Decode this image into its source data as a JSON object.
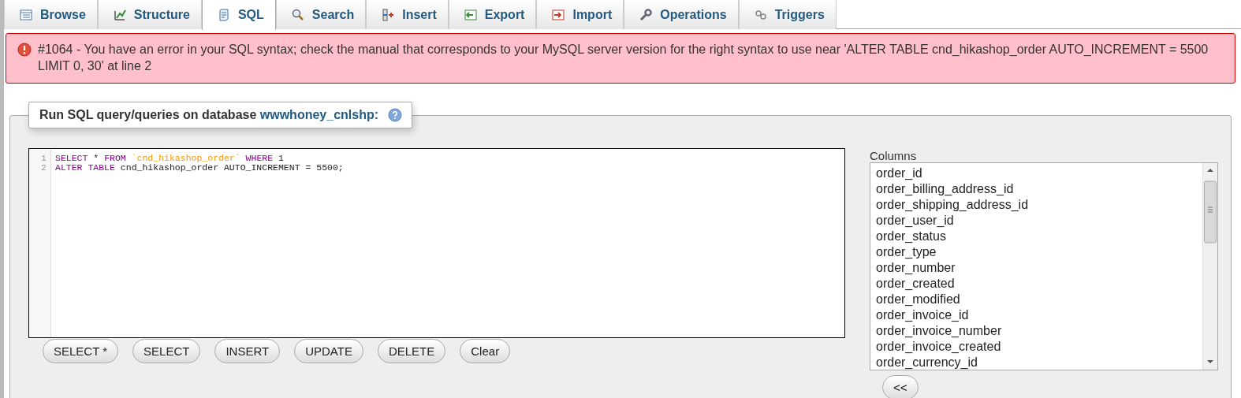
{
  "tabs": [
    {
      "label": "Browse",
      "selected": false
    },
    {
      "label": "Structure",
      "selected": false
    },
    {
      "label": "SQL",
      "selected": true
    },
    {
      "label": "Search",
      "selected": false
    },
    {
      "label": "Insert",
      "selected": false
    },
    {
      "label": "Export",
      "selected": false
    },
    {
      "label": "Import",
      "selected": false
    },
    {
      "label": "Operations",
      "selected": false
    },
    {
      "label": "Triggers",
      "selected": false
    }
  ],
  "error": {
    "message": "#1064 - You have an error in your SQL syntax; check the manual that corresponds to your MySQL server version for the right syntax to use near 'ALTER TABLE cnd_hikashop_order AUTO_INCREMENT = 5500 LIMIT 0, 30' at line 2"
  },
  "query_panel": {
    "legend": "Run SQL query/queries on database",
    "database": "wwwhoney_cnlshp:",
    "editor": {
      "lines": [
        {
          "number": "1",
          "tokens": [
            {
              "kind": "keyword",
              "text": "SELECT"
            },
            {
              "kind": "plain",
              "text": " * "
            },
            {
              "kind": "keyword",
              "text": "FROM "
            },
            {
              "kind": "string",
              "text": "`cnd_hikashop_order`"
            },
            {
              "kind": "keyword",
              "text": " WHERE"
            },
            {
              "kind": "plain",
              "text": " 1"
            }
          ]
        },
        {
          "number": "2",
          "tokens": [
            {
              "kind": "keyword",
              "text": "ALTER TABLE"
            },
            {
              "kind": "plain",
              "text": " cnd_hikashop_order AUTO_INCREMENT = 5500;"
            }
          ]
        }
      ]
    },
    "buttons": [
      "SELECT *",
      "SELECT",
      "INSERT",
      "UPDATE",
      "DELETE",
      "Clear"
    ],
    "columns": {
      "label": "Columns",
      "items": [
        "order_id",
        "order_billing_address_id",
        "order_shipping_address_id",
        "order_user_id",
        "order_status",
        "order_type",
        "order_number",
        "order_created",
        "order_modified",
        "order_invoice_id",
        "order_invoice_number",
        "order_invoice_created",
        "order_currency_id"
      ],
      "insert_button": "<<"
    }
  }
}
